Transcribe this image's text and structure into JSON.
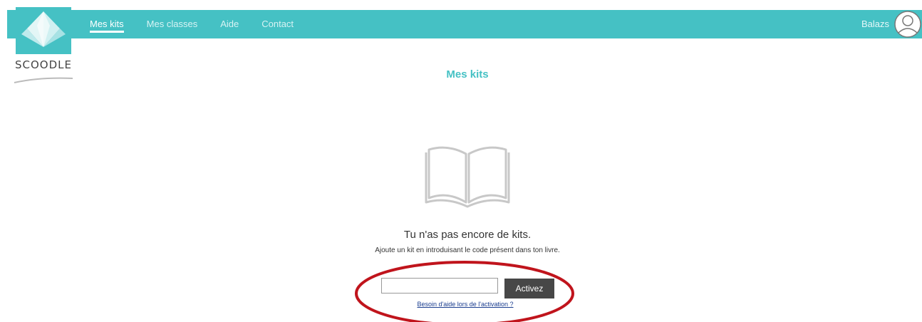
{
  "brand": {
    "name": "SCOODLE",
    "color": "#45c1c4"
  },
  "nav": {
    "items": [
      {
        "label": "Mes kits",
        "active": true
      },
      {
        "label": "Mes classes",
        "active": false
      },
      {
        "label": "Aide",
        "active": false
      },
      {
        "label": "Contact",
        "active": false
      }
    ],
    "user_name": "Balazs"
  },
  "page": {
    "title": "Mes kits",
    "empty_title": "Tu n'as pas encore de kits.",
    "empty_subtitle": "Ajoute un kit en introduisant le code présent dans ton livre."
  },
  "activation": {
    "code_value": "",
    "button_label": "Activez",
    "help_link": "Besoin d'aide lors de l'activation ?"
  },
  "icons": {
    "logo": "origami-logo-icon",
    "avatar": "user-avatar-icon",
    "book": "open-book-icon"
  },
  "colors": {
    "accent": "#45c1c4",
    "button": "#474747",
    "highlight": "#c0141c"
  }
}
